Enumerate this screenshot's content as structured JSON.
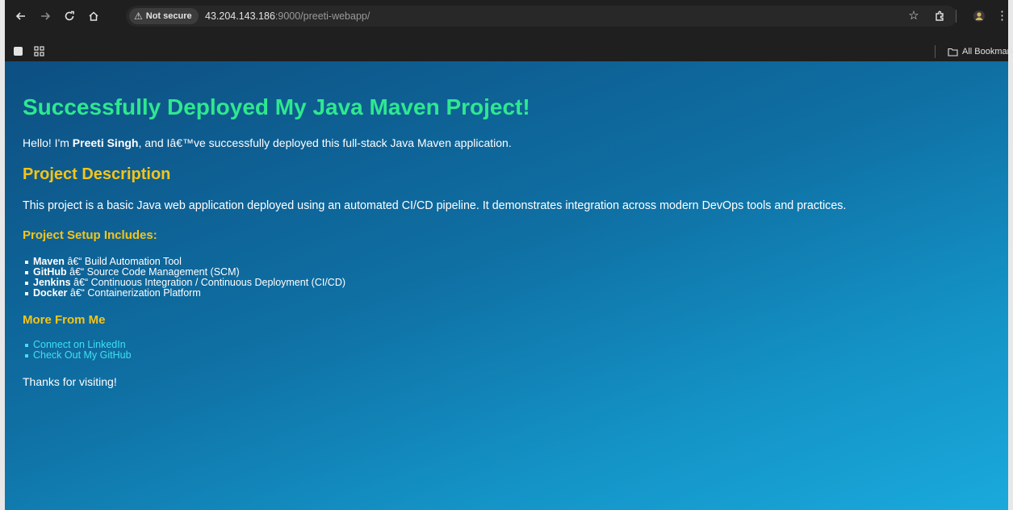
{
  "browser": {
    "security_label": "Not secure",
    "url_host": "43.204.143.186",
    "url_rest": ":9000/preeti-webapp/",
    "all_bookmarks_label": "All Bookmarks"
  },
  "page": {
    "title": "Successfully Deployed My Java Maven Project!",
    "intro": {
      "prefix": "Hello! I'm ",
      "name": "Preeti Singh",
      "suffix": ", and Iâ€™ve successfully deployed this full-stack Java Maven application."
    },
    "description_heading": "Project Description",
    "description": "This project is a basic Java web application deployed using an automated CI/CD pipeline. It demonstrates integration across modern DevOps tools and practices.",
    "setup_heading": "Project Setup Includes:",
    "setup_items": [
      {
        "name": "Maven",
        "detail": " â€“ Build Automation Tool"
      },
      {
        "name": "GitHub",
        "detail": " â€“ Source Code Management (SCM)"
      },
      {
        "name": "Jenkins",
        "detail": " â€“ Continuous Integration / Continuous Deployment (CI/CD)"
      },
      {
        "name": "Docker",
        "detail": " â€“ Containerization Platform"
      }
    ],
    "more_heading": "More From Me",
    "links": [
      {
        "label": "Connect on LinkedIn"
      },
      {
        "label": "Check Out My GitHub"
      }
    ],
    "thanks": "Thanks for visiting!"
  },
  "colors": {
    "title": "#2ee88f",
    "headings": "#f5c518",
    "links": "#3fe0f0"
  }
}
